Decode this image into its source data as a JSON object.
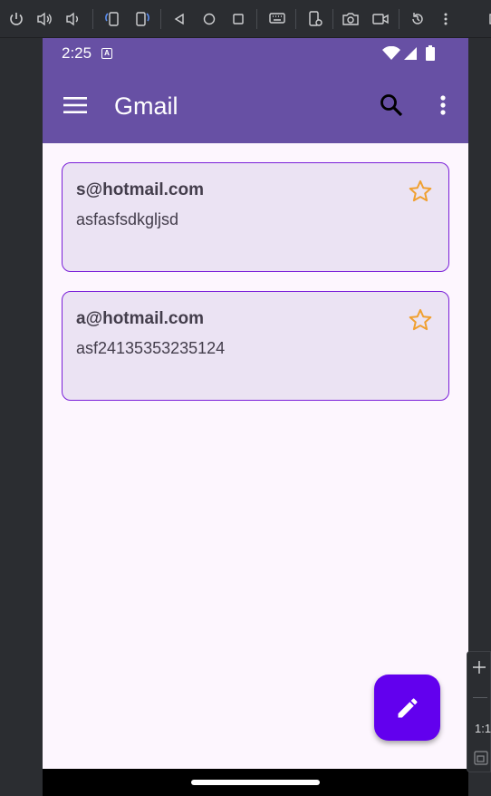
{
  "emulator_toolbar": {
    "buttons": [
      {
        "name": "power-icon"
      },
      {
        "name": "volume-up-icon"
      },
      {
        "name": "volume-down-icon"
      },
      {
        "name": "rotate-left-icon"
      },
      {
        "name": "rotate-right-icon"
      },
      {
        "name": "back-icon"
      },
      {
        "name": "home-icon"
      },
      {
        "name": "overview-icon"
      },
      {
        "name": "keyboard-icon"
      },
      {
        "name": "device-settings-icon"
      },
      {
        "name": "camera-icon"
      },
      {
        "name": "video-icon"
      },
      {
        "name": "restore-icon"
      },
      {
        "name": "more-vert-icon"
      }
    ]
  },
  "status_bar": {
    "time": "2:25",
    "notification_icon": "A"
  },
  "app_bar": {
    "title": "Gmail",
    "menu_icon": "menu-icon",
    "search_icon": "search-icon",
    "more_icon": "more-vert-icon",
    "background": "#6750a4"
  },
  "emails": [
    {
      "from": "s@hotmail.com",
      "body": "asfasfsdkgljsd",
      "starred": false
    },
    {
      "from": "a@hotmail.com",
      "body": "asf24135353235124",
      "starred": false
    }
  ],
  "fab": {
    "icon": "edit-icon",
    "color": "#6200ee"
  },
  "zoom_panel": {
    "zoom_label": "1:1"
  },
  "colors": {
    "card_bg": "#ebe3f3",
    "card_border": "#7a1fd8",
    "star": "#f0a030",
    "page_bg": "#fdf6fe"
  }
}
